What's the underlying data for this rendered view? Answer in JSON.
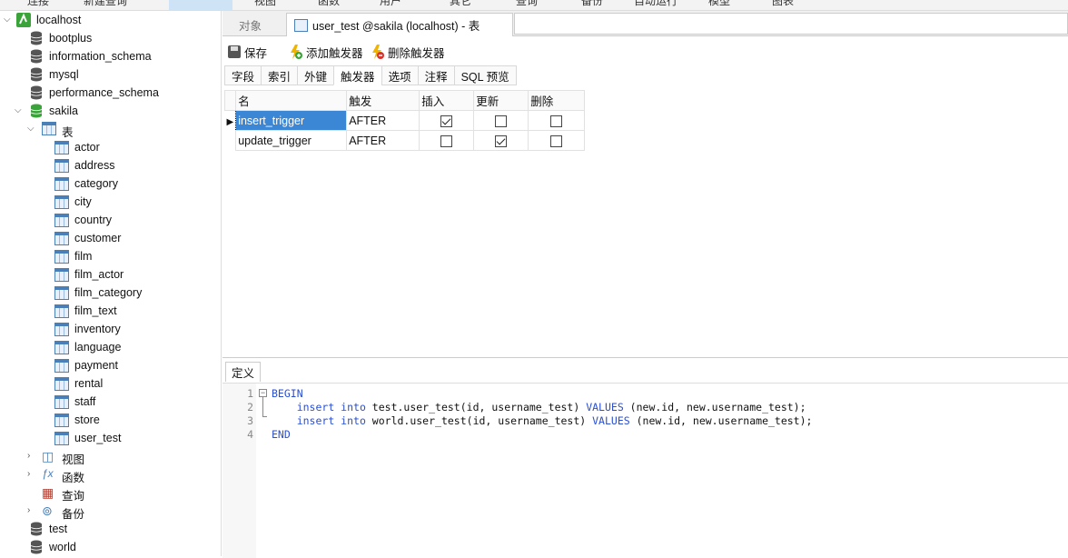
{
  "menubar": {
    "items": [
      "连接",
      "新建查询",
      "表",
      "视图",
      "函数",
      "用户",
      "其它",
      "查询",
      "备份",
      "自动运行",
      "模型",
      "图表"
    ],
    "active_index": 2
  },
  "sidebar": {
    "connection": "localhost",
    "databases_top": [
      "bootplus",
      "information_schema",
      "mysql",
      "performance_schema"
    ],
    "open_db": "sakila",
    "tables_node": "表",
    "tables": [
      "actor",
      "address",
      "category",
      "city",
      "country",
      "customer",
      "film",
      "film_actor",
      "film_category",
      "film_text",
      "inventory",
      "language",
      "payment",
      "rental",
      "staff",
      "store",
      "user_test"
    ],
    "selected_table": "user_test",
    "other_nodes": [
      "视图",
      "函数",
      "查询",
      "备份"
    ],
    "databases_bottom": [
      "test",
      "world"
    ]
  },
  "tabs": {
    "objects": "对象",
    "editor": "user_test @sakila (localhost) - 表"
  },
  "toolbar": {
    "save": "保存",
    "add_trigger": "添加触发器",
    "delete_trigger": "删除触发器"
  },
  "subtabs": [
    "字段",
    "索引",
    "外键",
    "触发器",
    "选项",
    "注释",
    "SQL 预览"
  ],
  "active_subtab": "触发器",
  "trigger_table": {
    "headers": [
      "名",
      "触发",
      "插入",
      "更新",
      "删除"
    ],
    "rows": [
      {
        "name": "insert_trigger",
        "timing": "AFTER",
        "insert": true,
        "update": false,
        "delete": false
      },
      {
        "name": "update_trigger",
        "timing": "AFTER",
        "insert": false,
        "update": true,
        "delete": false
      }
    ]
  },
  "definition": {
    "tab_label": "定义",
    "line_numbers": [
      "1",
      "2",
      "3",
      "4"
    ],
    "lines": [
      [
        {
          "t": "BEGIN",
          "kw": true
        }
      ],
      [
        {
          "t": "    ",
          "kw": false
        },
        {
          "t": "insert into",
          "kw": true
        },
        {
          "t": " test.user_test(id, username_test) ",
          "kw": false
        },
        {
          "t": "VALUES",
          "kw": true
        },
        {
          "t": " (new.id, new.username_test);",
          "kw": false
        }
      ],
      [
        {
          "t": "    ",
          "kw": false
        },
        {
          "t": "insert into",
          "kw": true
        },
        {
          "t": " world.user_test(id, username_test) ",
          "kw": false
        },
        {
          "t": "VALUES",
          "kw": true
        },
        {
          "t": " (new.id, new.username_test);",
          "kw": false
        }
      ],
      [
        {
          "t": "END",
          "kw": true
        }
      ]
    ]
  },
  "colors": {
    "selection_bg": "#3b87d6",
    "keyword": "#2a4fd1",
    "db_open": "#3aa43a",
    "table_icon": "#4a7fb8"
  }
}
